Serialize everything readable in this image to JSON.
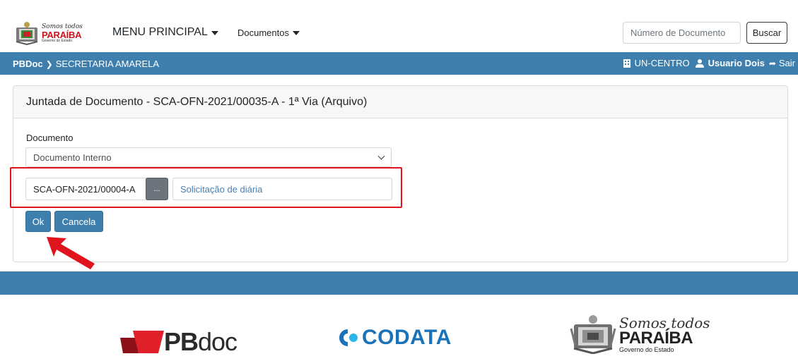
{
  "navbar": {
    "logo": {
      "slogan": "Somos todos",
      "state": "PARAÍBA",
      "subtitle": "Governo do Estado"
    },
    "menu_main": "MENU PRINCIPAL",
    "menu_documents": "Documentos",
    "search_placeholder": "Número de Documento",
    "search_button": "Buscar"
  },
  "topbar": {
    "app_name": "PBDoc",
    "location": "SECRETARIA AMARELA",
    "unit": "UN-CENTRO",
    "user": "Usuario Dois",
    "exit": "Sair"
  },
  "form": {
    "title": "Juntada de Documento - SCA-OFN-2021/00035-A - 1ª Via (Arquivo)",
    "document_label": "Documento",
    "document_type_selected": "Documento Interno",
    "document_code": "SCA-OFN-2021/00004-A",
    "lookup_button": "...",
    "document_description": "Solicitação de diária",
    "ok_button": "Ok",
    "cancel_button": "Cancela"
  },
  "footer": {
    "pbdoc_bold": "PB",
    "pbdoc_light": "doc",
    "codata": "CODATA",
    "pb_slogan": "Somos todos",
    "pb_state": "PARAÍBA",
    "pb_subtitle": "Governo do Estado"
  },
  "colors": {
    "primary_blue": "#3f7fae",
    "highlight_red": "#e0141c",
    "codata_blue": "#1a72b9"
  }
}
